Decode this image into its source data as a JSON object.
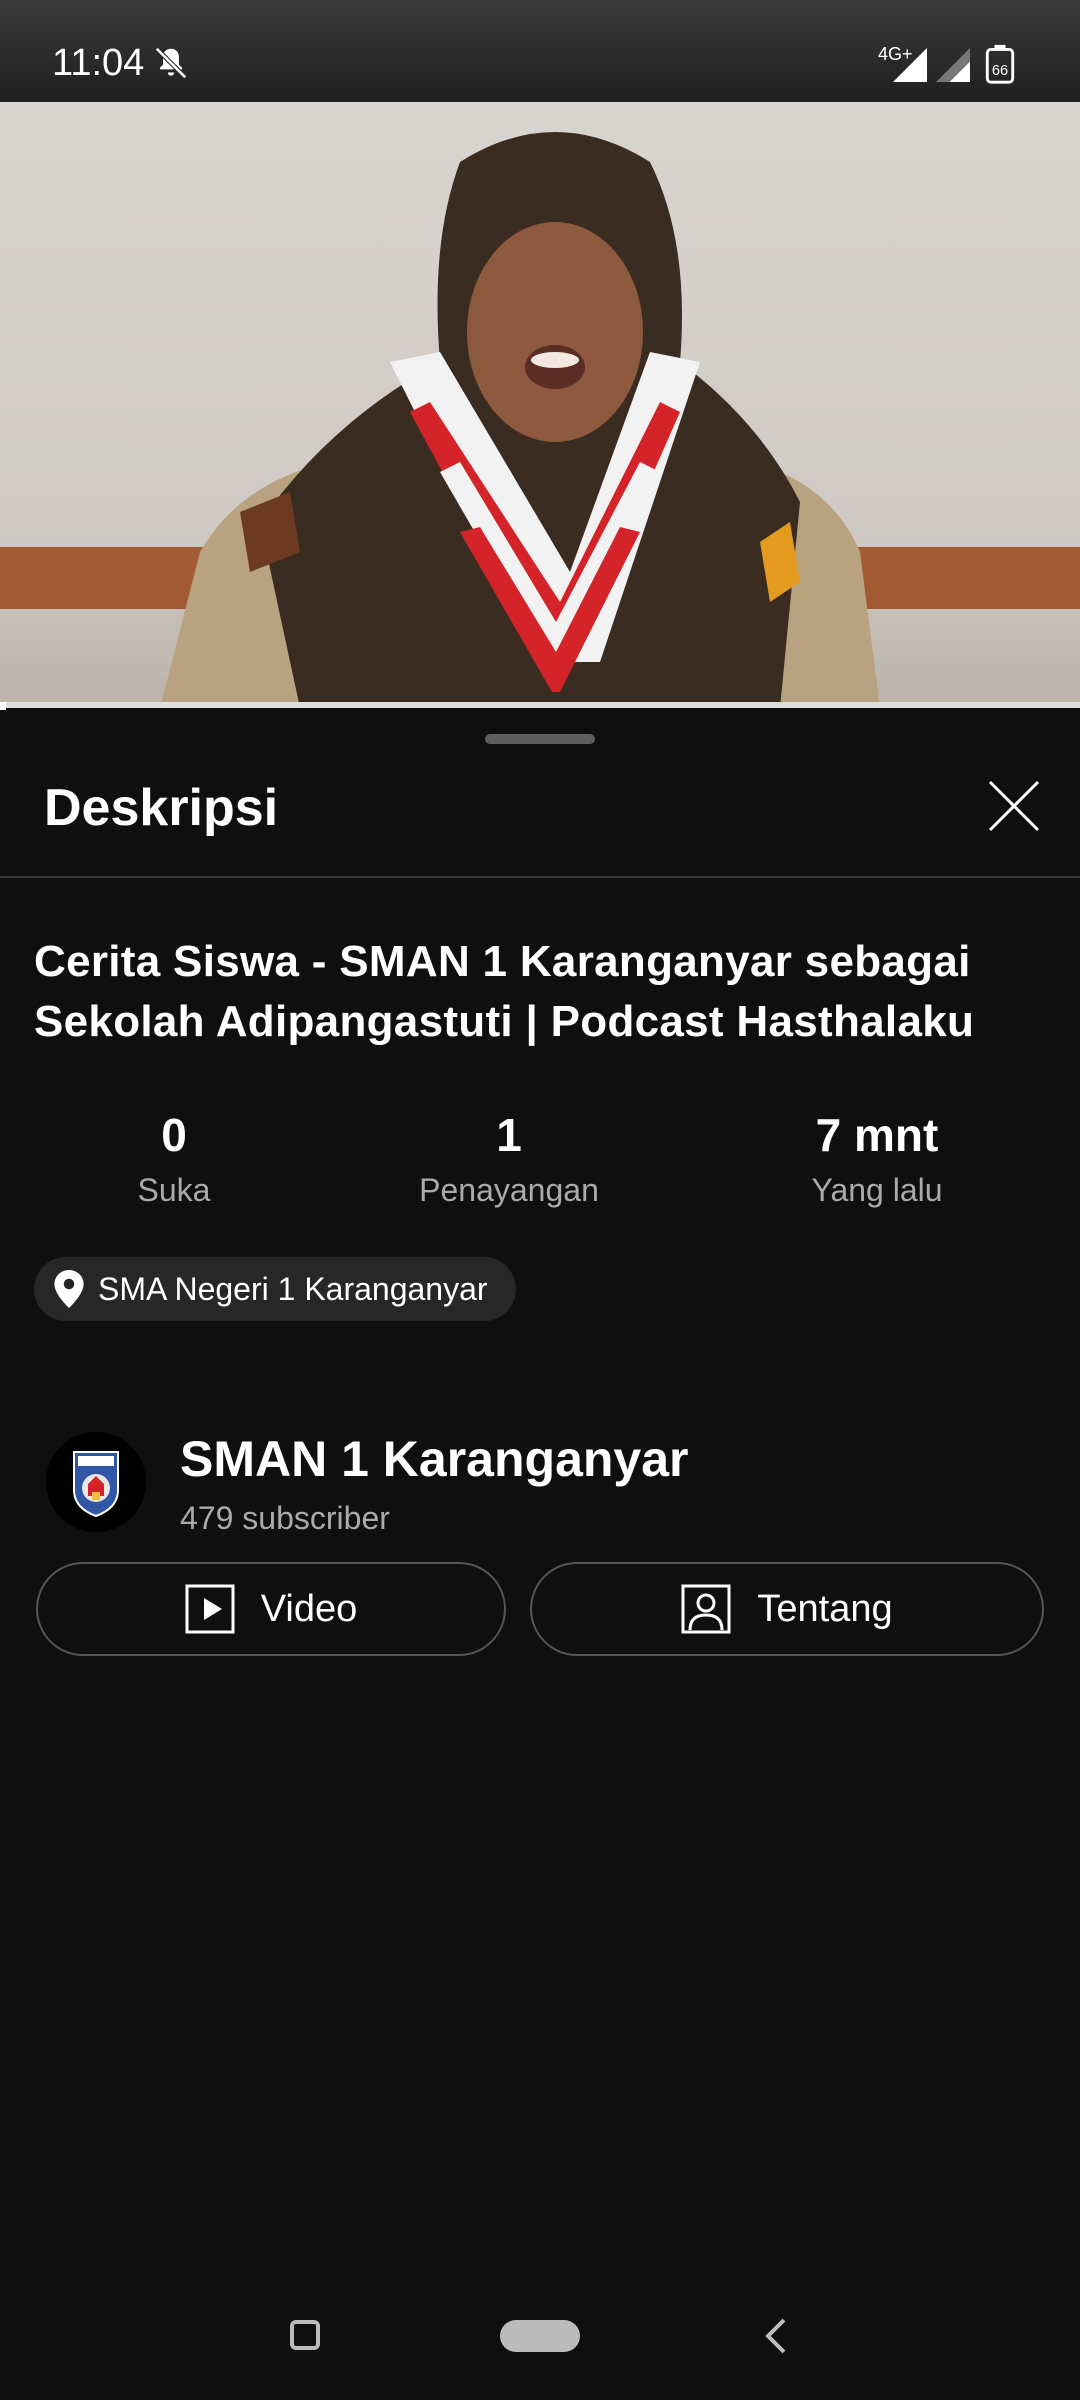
{
  "status_bar": {
    "time": "11:04",
    "network": "4G+",
    "battery": "66"
  },
  "sheet": {
    "title": "Deskripsi"
  },
  "video": {
    "title": "Cerita Siswa - SMAN 1 Karanganyar sebagai Sekolah Adipangastuti | Podcast Hasthalaku"
  },
  "stats": [
    {
      "value": "0",
      "label": "Suka"
    },
    {
      "value": "1",
      "label": "Penayangan"
    },
    {
      "value": "7 mnt",
      "label": "Yang lalu"
    }
  ],
  "location": {
    "label": "SMA Negeri 1 Karanganyar"
  },
  "channel": {
    "name": "SMAN 1 Karanganyar",
    "subscribers": "479 subscriber",
    "video_button": "Video",
    "about_button": "Tentang"
  },
  "colors": {
    "background": "#0f0f0f",
    "chip": "#272727",
    "secondary_text": "#aaaaaa",
    "scarf_red": "#d4242a"
  },
  "icons": [
    "mute-bell-icon",
    "signal-icon",
    "battery-icon",
    "close-icon",
    "location-pin-icon",
    "play-square-icon",
    "person-square-icon"
  ]
}
